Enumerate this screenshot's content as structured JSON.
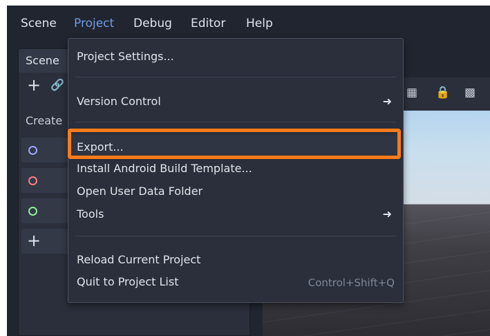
{
  "menubar": {
    "items": [
      {
        "label": "Scene",
        "active": false
      },
      {
        "label": "Project",
        "active": true
      },
      {
        "label": "Debug",
        "active": false
      },
      {
        "label": "Editor",
        "active": false
      },
      {
        "label": "Help",
        "active": false
      }
    ]
  },
  "scene_dock": {
    "tab_label": "Scene",
    "create_label": "Create",
    "add_icon": "plus-icon",
    "link_icon": "link-icon",
    "node_buttons": [
      {
        "icon": "node2d-ring-icon",
        "color": "#9ea6ff"
      },
      {
        "icon": "node3d-ring-icon",
        "color": "#fc7f7f"
      },
      {
        "icon": "control-ring-icon",
        "color": "#8eef97"
      },
      {
        "icon": "plus-icon",
        "color": "#e0e4ec"
      }
    ]
  },
  "viewport_toolbar": {
    "icons": [
      "snap-icon",
      "lock-icon",
      "group-icon"
    ]
  },
  "project_menu": {
    "project_settings": "Project Settings...",
    "version_control": "Version Control",
    "export": "Export...",
    "install_android": "Install Android Build Template...",
    "open_user_data": "Open User Data Folder",
    "tools": "Tools",
    "reload": "Reload Current Project",
    "quit": "Quit to Project List",
    "quit_shortcut": "Control+Shift+Q",
    "submenu_arrow": "➜"
  },
  "colors": {
    "accent_menu": "#6f9de6",
    "highlight": "#ff7b1a",
    "background": "#212530",
    "panel": "#2a2f3b"
  }
}
